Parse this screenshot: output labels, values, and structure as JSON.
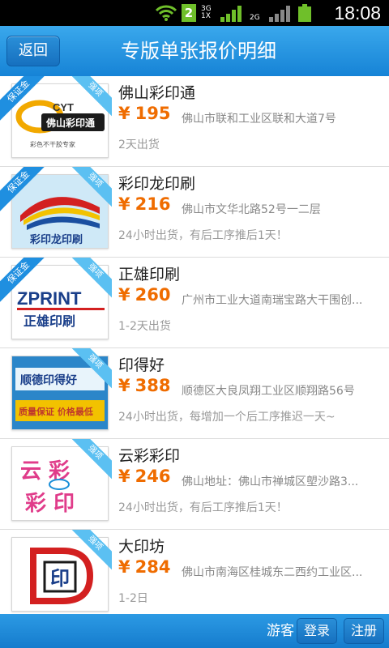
{
  "status_bar": {
    "time": "18:08",
    "sim_slot": "2",
    "net_a_top": "3G",
    "net_a_bottom": "1X",
    "net_b": "2G"
  },
  "header": {
    "back_label": "返回",
    "title": "专版单张报价明细"
  },
  "badges": {
    "deposit": "保证金",
    "strong": "强项"
  },
  "logos": {
    "cyt_brand": "CYT",
    "cyt_name": "佛山彩印通",
    "cyt_slogan": "彩色不干胶专家",
    "cyl_name": "彩印龙印刷",
    "zprint_brand": "ZPRINT",
    "zprint_name": "正雄印刷",
    "ydh_name": "顺德印得好",
    "ydh_slogan": "质量保证 价格最低",
    "yc_line1": "云 彩",
    "yc_line2": "彩 印",
    "dyf_letters": "印"
  },
  "items": [
    {
      "name": "佛山彩印通",
      "currency": "¥",
      "price": "195",
      "address": "佛山市联和工业区联和大道7号",
      "delivery": "2天出货",
      "deposit": true
    },
    {
      "name": "彩印龙印刷",
      "currency": "¥",
      "price": "216",
      "address": "佛山市文华北路52号一二层",
      "delivery": "24小时出货，有后工序推后1天！",
      "deposit": true
    },
    {
      "name": "正雄印刷",
      "currency": "¥",
      "price": "260",
      "address": "广州市工业大道南瑞宝路大干围创...",
      "delivery": "1-2天出货",
      "deposit": true
    },
    {
      "name": "印得好",
      "currency": "¥",
      "price": "388",
      "address": "顺德区大良凤翔工业区顺翔路56号",
      "delivery": "24小时出货，每增加一个后工序推迟一天~",
      "deposit": false
    },
    {
      "name": "云彩彩印",
      "currency": "¥",
      "price": "246",
      "address": "佛山地址：佛山市禅城区塱沙路3...",
      "delivery": "24小时出货，有后工序推后1天！",
      "deposit": false
    },
    {
      "name": "大印坊",
      "currency": "¥",
      "price": "284",
      "address": "佛山市南海区桂城东二西约工业区...",
      "delivery": "1-2日",
      "deposit": false
    }
  ],
  "footer": {
    "guest_label": "游客",
    "login_label": "登录",
    "register_label": "注册"
  },
  "colors": {
    "accent": "#1f8fe0",
    "price": "#ef6c00",
    "status_green": "#6fbf2a"
  }
}
